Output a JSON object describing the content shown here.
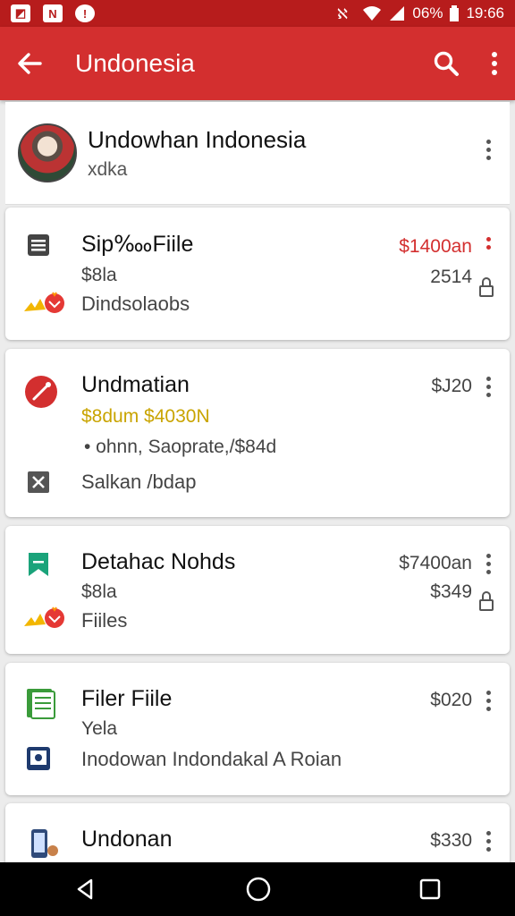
{
  "status": {
    "battery_pct": "06%",
    "time": "19:66"
  },
  "appbar": {
    "title": "Undonesia"
  },
  "header": {
    "title": "Undowhan Indonesia",
    "subtitle": "xdka"
  },
  "items": [
    {
      "title": "Sip‱Fiile",
      "line2": "$8la",
      "line3": "Dindsolaobs",
      "amount": "$1400an",
      "amount2": "2514"
    },
    {
      "title": "Undmatian",
      "line2": "$8dum $4030N",
      "line3": "• ohnn, Saoprate,/$84d",
      "line4": "Salkan /bdap",
      "amount": "$J20"
    },
    {
      "title": "Detahac Nohds",
      "line2": "$8la",
      "line3": "Fiiles",
      "amount": "$7400an",
      "amount2": "$349"
    },
    {
      "title": "Filer Fiile",
      "line2": "Yela",
      "line3": "Inodowan Indondakal A Roian",
      "amount": "$020"
    },
    {
      "title": "Undonan",
      "amount": "$330"
    }
  ],
  "icons": {
    "back": "back-arrow-icon",
    "search": "search-icon",
    "more": "more-vert-icon",
    "lock": "lock-icon",
    "nav_back": "nav-back-icon",
    "nav_home": "nav-home-icon",
    "nav_recent": "nav-recents-icon"
  },
  "colors": {
    "appbar": "#d32f2f",
    "statusbar": "#b71c1c",
    "accent_red": "#d32f2f",
    "amount_yellow": "#c9a400",
    "bookmark_green": "#1aa37a"
  }
}
